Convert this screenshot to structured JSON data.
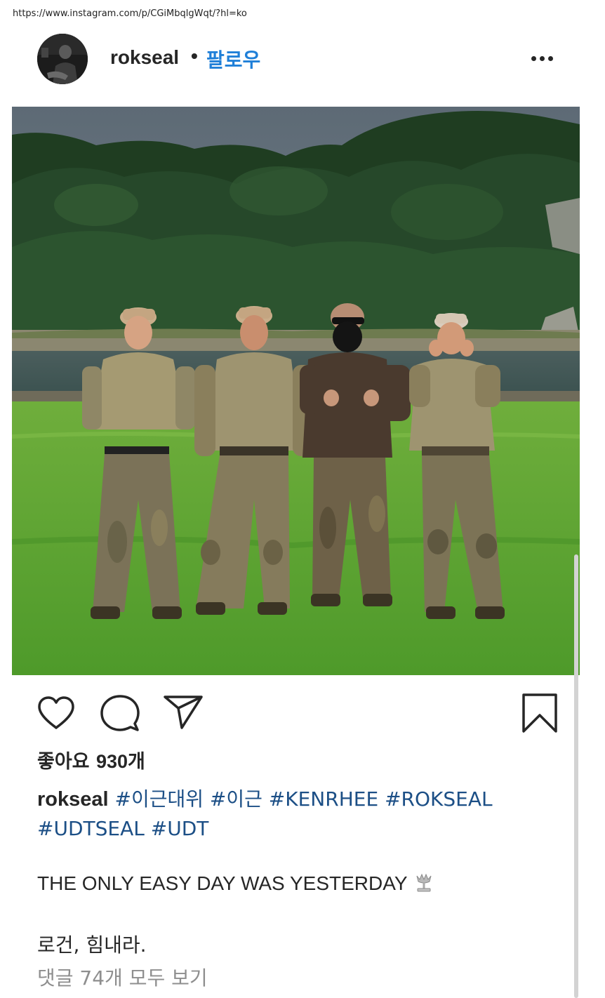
{
  "browser": {
    "url": "https://www.instagram.com/p/CGiMbqlgWqt/?hl=ko"
  },
  "post": {
    "username": "rokseal",
    "separator": "•",
    "follow_label": "팔로우",
    "more_icon": "more-horizontal-icon",
    "image_alt": "Four men in camouflage uniforms standing on grass in front of a lake and forested mountains",
    "actions": {
      "like_icon": "heart-icon",
      "comment_icon": "comment-icon",
      "share_icon": "paper-plane-icon",
      "save_icon": "bookmark-icon"
    },
    "likes_label": "좋아요",
    "likes_count": "930개",
    "caption": {
      "username": "rokseal",
      "hashtags": [
        "#이근대위",
        "#이근",
        "#KENRHEE",
        "#ROKSEAL",
        "#UDTSEAL",
        "#UDT"
      ],
      "motto": "THE ONLY EASY DAY WAS YESTERDAY",
      "motto_icon": "trident-icon",
      "message": "로건, 힘내라."
    },
    "view_comments": "댓글 74개 모두 보기"
  },
  "colors": {
    "link_blue": "#1f7fd8",
    "hashtag_blue": "#1c4f86",
    "text": "#262626",
    "muted": "#8e8e8e"
  }
}
